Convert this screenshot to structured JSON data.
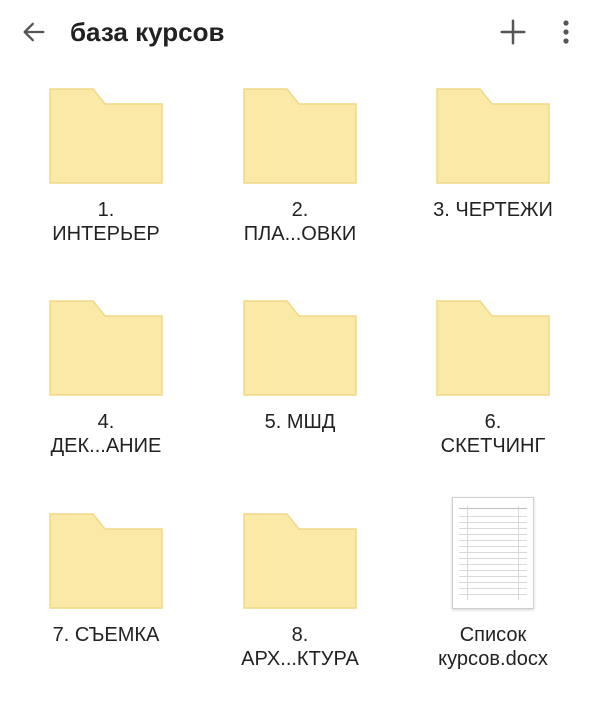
{
  "header": {
    "title": "база курсов",
    "back_icon": "arrow-left-icon",
    "add_icon": "plus-icon",
    "more_icon": "more-vertical-icon"
  },
  "colors": {
    "folder_fill": "#FBE9A8",
    "folder_stroke": "#F0D887",
    "icon_gray": "#555555",
    "text": "#222222"
  },
  "items": [
    {
      "type": "folder",
      "name_line1": "1.",
      "name_line2": "ИНТЕРЬЕР"
    },
    {
      "type": "folder",
      "name_line1": "2.",
      "name_line2": "ПЛА...ОВКИ"
    },
    {
      "type": "folder",
      "name_line1": "3. ЧЕРТЕЖИ",
      "name_line2": ""
    },
    {
      "type": "folder",
      "name_line1": "4.",
      "name_line2": "ДЕК...АНИЕ"
    },
    {
      "type": "folder",
      "name_line1": "5. МШД",
      "name_line2": ""
    },
    {
      "type": "folder",
      "name_line1": "6.",
      "name_line2": "СКЕТЧИНГ"
    },
    {
      "type": "folder",
      "name_line1": "7. СЪЕМКА",
      "name_line2": ""
    },
    {
      "type": "folder",
      "name_line1": "8.",
      "name_line2": "АРХ...КТУРА"
    },
    {
      "type": "document",
      "name_line1": "Список",
      "name_line2": "курсов.docx"
    }
  ]
}
